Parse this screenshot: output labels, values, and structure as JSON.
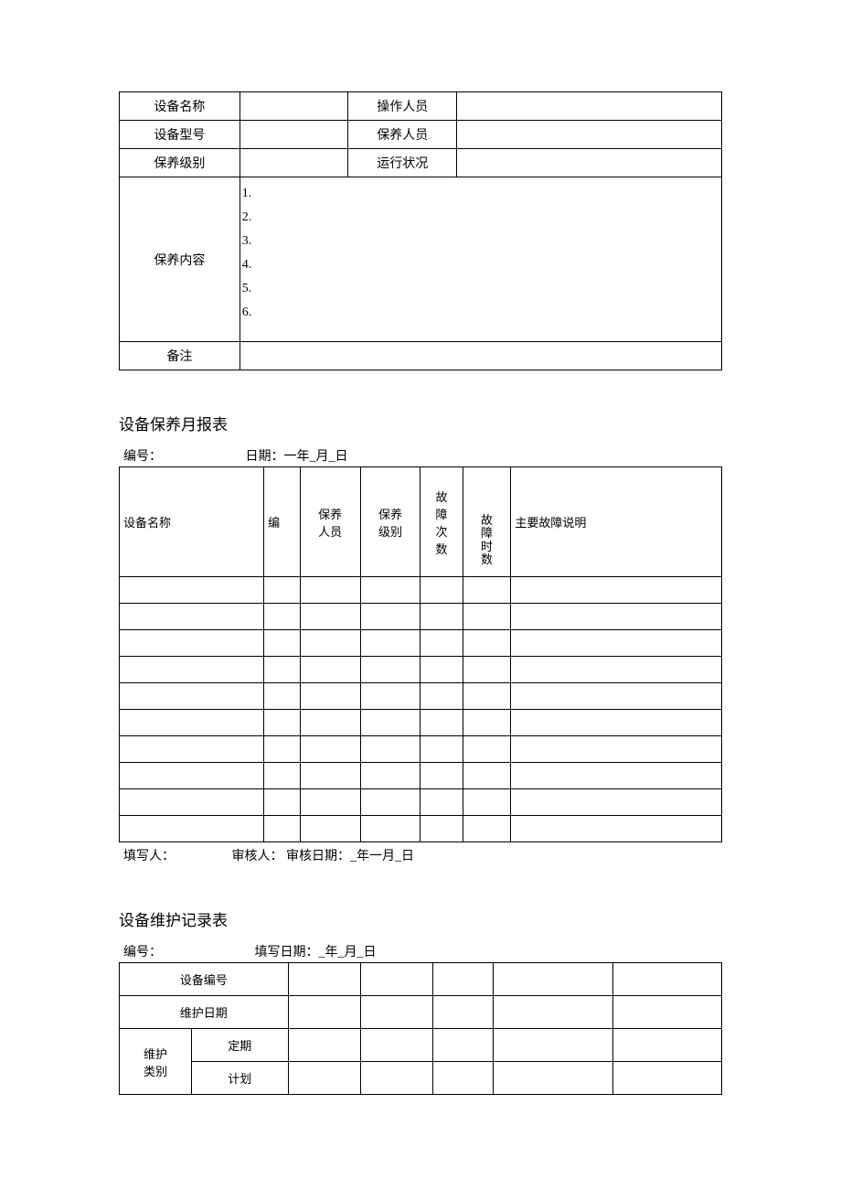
{
  "table1": {
    "row1_left": "设备名称",
    "row1_right": "操作人员",
    "row2_left": "设备型号",
    "row2_right": "保养人员",
    "row3_left": "保养级别",
    "row3_right": "运行状况",
    "row4_label": "保养内容",
    "items": [
      "1.",
      "2.",
      "3.",
      "4.",
      "5.",
      "6."
    ],
    "row5_label": "备注"
  },
  "section2": {
    "title": "设备保养月报表",
    "meta_num": "编号：",
    "meta_date": "日期：一年_月_日",
    "headers": {
      "h1": "设备名称",
      "h2": "编",
      "h3": "保养人员",
      "h4": "保养级别",
      "h5": "故障次数",
      "h6": "故障时数",
      "h7": "主要故障说明"
    },
    "footer_fill": "填写人：",
    "footer_review": "审核人：",
    "footer_date": "审核日期：_年一月_日"
  },
  "section3": {
    "title": "设备维护记录表",
    "meta_num": "编号：",
    "meta_date": "填写日期：_年_月_日",
    "row1": "设备编号",
    "row2": "维护日期",
    "row3_left": "维护类别",
    "row3_right1": "定期",
    "row3_right2": "计划"
  }
}
